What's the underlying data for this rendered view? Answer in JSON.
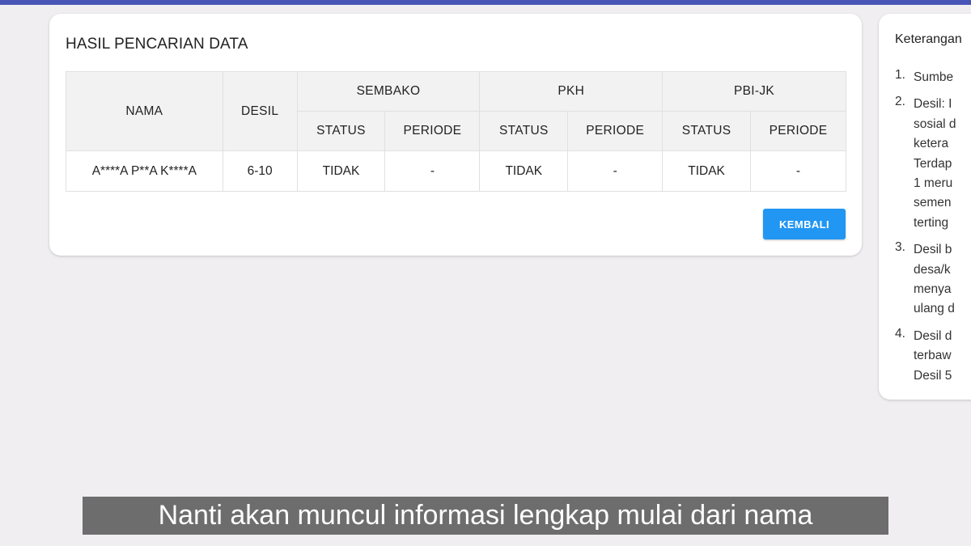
{
  "colors": {
    "top_bar": "#4a55b8",
    "button": "#2196f3",
    "background": "#f0eef1"
  },
  "main": {
    "title": "HASIL PENCARIAN DATA",
    "table": {
      "headers": {
        "nama": "NAMA",
        "desil": "DESIL",
        "sembako": "SEMBAKO",
        "pkh": "PKH",
        "pbijk": "PBI-JK",
        "status": "STATUS",
        "periode": "PERIODE"
      },
      "rows": [
        {
          "nama": "A****A P**A K****A",
          "desil": "6-10",
          "sembako_status": "TIDAK",
          "sembako_periode": "-",
          "pkh_status": "TIDAK",
          "pkh_periode": "-",
          "pbijk_status": "TIDAK",
          "pbijk_periode": "-"
        }
      ]
    },
    "back_button": "KEMBALI"
  },
  "side": {
    "title": "Keterangan",
    "items": [
      {
        "num": "1.",
        "lines": [
          "Sumbe"
        ]
      },
      {
        "num": "2.",
        "lines": [
          "Desil: I",
          "sosial d",
          "ketera",
          "Terdap",
          "1 meru",
          "semen",
          "terting"
        ]
      },
      {
        "num": "3.",
        "lines": [
          "Desil b",
          "desa/k",
          "menya",
          "ulang d"
        ]
      },
      {
        "num": "4.",
        "lines": [
          "Desil d",
          "terbaw",
          "Desil 5"
        ]
      }
    ]
  },
  "subtitle": "Nanti akan muncul informasi lengkap mulai dari nama"
}
